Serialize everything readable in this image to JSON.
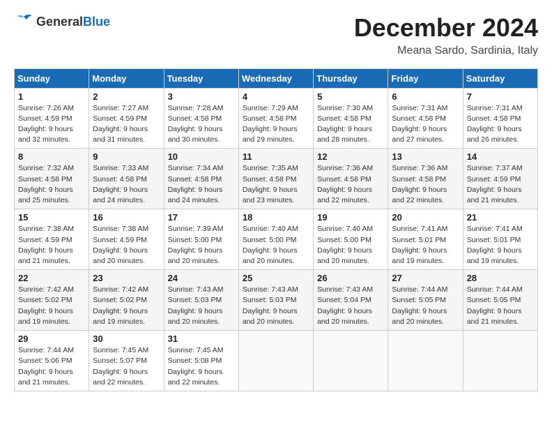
{
  "logo": {
    "text_general": "General",
    "text_blue": "Blue"
  },
  "title": "December 2024",
  "subtitle": "Meana Sardo, Sardinia, Italy",
  "days_of_week": [
    "Sunday",
    "Monday",
    "Tuesday",
    "Wednesday",
    "Thursday",
    "Friday",
    "Saturday"
  ],
  "weeks": [
    [
      {
        "day": "1",
        "info": "Sunrise: 7:26 AM\nSunset: 4:59 PM\nDaylight: 9 hours\nand 32 minutes."
      },
      {
        "day": "2",
        "info": "Sunrise: 7:27 AM\nSunset: 4:59 PM\nDaylight: 9 hours\nand 31 minutes."
      },
      {
        "day": "3",
        "info": "Sunrise: 7:28 AM\nSunset: 4:58 PM\nDaylight: 9 hours\nand 30 minutes."
      },
      {
        "day": "4",
        "info": "Sunrise: 7:29 AM\nSunset: 4:58 PM\nDaylight: 9 hours\nand 29 minutes."
      },
      {
        "day": "5",
        "info": "Sunrise: 7:30 AM\nSunset: 4:58 PM\nDaylight: 9 hours\nand 28 minutes."
      },
      {
        "day": "6",
        "info": "Sunrise: 7:31 AM\nSunset: 4:58 PM\nDaylight: 9 hours\nand 27 minutes."
      },
      {
        "day": "7",
        "info": "Sunrise: 7:31 AM\nSunset: 4:58 PM\nDaylight: 9 hours\nand 26 minutes."
      }
    ],
    [
      {
        "day": "8",
        "info": "Sunrise: 7:32 AM\nSunset: 4:58 PM\nDaylight: 9 hours\nand 25 minutes."
      },
      {
        "day": "9",
        "info": "Sunrise: 7:33 AM\nSunset: 4:58 PM\nDaylight: 9 hours\nand 24 minutes."
      },
      {
        "day": "10",
        "info": "Sunrise: 7:34 AM\nSunset: 4:58 PM\nDaylight: 9 hours\nand 24 minutes."
      },
      {
        "day": "11",
        "info": "Sunrise: 7:35 AM\nSunset: 4:58 PM\nDaylight: 9 hours\nand 23 minutes."
      },
      {
        "day": "12",
        "info": "Sunrise: 7:36 AM\nSunset: 4:58 PM\nDaylight: 9 hours\nand 22 minutes."
      },
      {
        "day": "13",
        "info": "Sunrise: 7:36 AM\nSunset: 4:58 PM\nDaylight: 9 hours\nand 22 minutes."
      },
      {
        "day": "14",
        "info": "Sunrise: 7:37 AM\nSunset: 4:59 PM\nDaylight: 9 hours\nand 21 minutes."
      }
    ],
    [
      {
        "day": "15",
        "info": "Sunrise: 7:38 AM\nSunset: 4:59 PM\nDaylight: 9 hours\nand 21 minutes."
      },
      {
        "day": "16",
        "info": "Sunrise: 7:38 AM\nSunset: 4:59 PM\nDaylight: 9 hours\nand 20 minutes."
      },
      {
        "day": "17",
        "info": "Sunrise: 7:39 AM\nSunset: 5:00 PM\nDaylight: 9 hours\nand 20 minutes."
      },
      {
        "day": "18",
        "info": "Sunrise: 7:40 AM\nSunset: 5:00 PM\nDaylight: 9 hours\nand 20 minutes."
      },
      {
        "day": "19",
        "info": "Sunrise: 7:40 AM\nSunset: 5:00 PM\nDaylight: 9 hours\nand 20 minutes."
      },
      {
        "day": "20",
        "info": "Sunrise: 7:41 AM\nSunset: 5:01 PM\nDaylight: 9 hours\nand 19 minutes."
      },
      {
        "day": "21",
        "info": "Sunrise: 7:41 AM\nSunset: 5:01 PM\nDaylight: 9 hours\nand 19 minutes."
      }
    ],
    [
      {
        "day": "22",
        "info": "Sunrise: 7:42 AM\nSunset: 5:02 PM\nDaylight: 9 hours\nand 19 minutes."
      },
      {
        "day": "23",
        "info": "Sunrise: 7:42 AM\nSunset: 5:02 PM\nDaylight: 9 hours\nand 19 minutes."
      },
      {
        "day": "24",
        "info": "Sunrise: 7:43 AM\nSunset: 5:03 PM\nDaylight: 9 hours\nand 20 minutes."
      },
      {
        "day": "25",
        "info": "Sunrise: 7:43 AM\nSunset: 5:03 PM\nDaylight: 9 hours\nand 20 minutes."
      },
      {
        "day": "26",
        "info": "Sunrise: 7:43 AM\nSunset: 5:04 PM\nDaylight: 9 hours\nand 20 minutes."
      },
      {
        "day": "27",
        "info": "Sunrise: 7:44 AM\nSunset: 5:05 PM\nDaylight: 9 hours\nand 20 minutes."
      },
      {
        "day": "28",
        "info": "Sunrise: 7:44 AM\nSunset: 5:05 PM\nDaylight: 9 hours\nand 21 minutes."
      }
    ],
    [
      {
        "day": "29",
        "info": "Sunrise: 7:44 AM\nSunset: 5:06 PM\nDaylight: 9 hours\nand 21 minutes."
      },
      {
        "day": "30",
        "info": "Sunrise: 7:45 AM\nSunset: 5:07 PM\nDaylight: 9 hours\nand 22 minutes."
      },
      {
        "day": "31",
        "info": "Sunrise: 7:45 AM\nSunset: 5:08 PM\nDaylight: 9 hours\nand 22 minutes."
      },
      {
        "day": "",
        "info": ""
      },
      {
        "day": "",
        "info": ""
      },
      {
        "day": "",
        "info": ""
      },
      {
        "day": "",
        "info": ""
      }
    ]
  ]
}
